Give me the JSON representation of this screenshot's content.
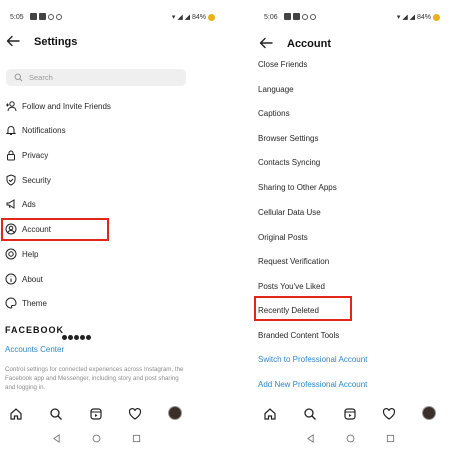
{
  "left": {
    "status": {
      "time": "5:05",
      "battery": "84%"
    },
    "header": {
      "title": "Settings"
    },
    "search": {
      "placeholder": "Search"
    },
    "items": [
      {
        "label": "Follow and Invite Friends",
        "icon": "add-person-icon"
      },
      {
        "label": "Notifications",
        "icon": "bell-icon"
      },
      {
        "label": "Privacy",
        "icon": "lock-icon"
      },
      {
        "label": "Security",
        "icon": "shield-icon"
      },
      {
        "label": "Ads",
        "icon": "megaphone-icon"
      },
      {
        "label": "Account",
        "icon": "account-circle-icon"
      },
      {
        "label": "Help",
        "icon": "lifebuoy-icon"
      },
      {
        "label": "About",
        "icon": "info-icon"
      },
      {
        "label": "Theme",
        "icon": "palette-icon"
      }
    ],
    "meta_section": {
      "brand": "FACEBOOK",
      "accounts_center": "Accounts Center",
      "description": "Control settings for connected experiences across Instagram, the Facebook app and Messenger, including story and post sharing and logging in."
    }
  },
  "right": {
    "status": {
      "time": "5:06",
      "battery": "84%"
    },
    "header": {
      "title": "Account"
    },
    "items": [
      "Close Friends",
      "Language",
      "Captions",
      "Browser Settings",
      "Contacts Syncing",
      "Sharing to Other Apps",
      "Cellular Data Use",
      "Original Posts",
      "Request Verification",
      "Posts You've Liked",
      "Recently Deleted",
      "Branded Content Tools"
    ],
    "links": [
      "Switch to Professional Account",
      "Add New Professional Account"
    ]
  },
  "colors": {
    "highlight": "#e3261b",
    "link": "#2c87c9",
    "battery": "#e9b21a"
  }
}
